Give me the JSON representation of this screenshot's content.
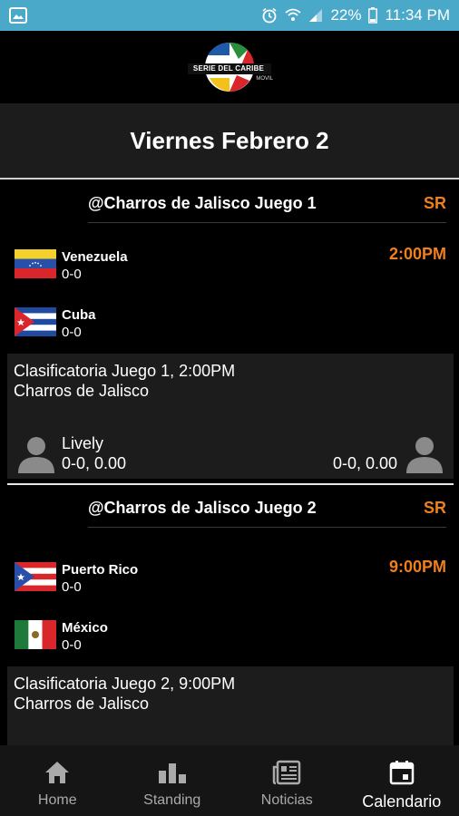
{
  "status_bar": {
    "battery_percent": "22%",
    "time": "11:34 PM"
  },
  "header": {
    "logo_text": "SERIE DEL CARIBE",
    "logo_sub": "MOVIL",
    "date_title": "Viernes Febrero 2"
  },
  "games": [
    {
      "title": "@Charros de Jalisco Juego 1",
      "status": "SR",
      "time": "2:00PM",
      "teams": [
        {
          "name": "Venezuela",
          "record": "0-0",
          "flag": "venezuela-flag-icon"
        },
        {
          "name": "Cuba",
          "record": "0-0",
          "flag": "cuba-flag-icon"
        }
      ],
      "info_line1": "Clasificatoria Juego 1, 2:00PM",
      "info_line2": "Charros de Jalisco",
      "pitcher_left_name": "Lively",
      "pitcher_left_stats": "0-0, 0.00",
      "pitcher_right_stats": "0-0, 0.00"
    },
    {
      "title": "@Charros de Jalisco Juego 2",
      "status": "SR",
      "time": "9:00PM",
      "teams": [
        {
          "name": "Puerto Rico",
          "record": "0-0",
          "flag": "puerto-rico-flag-icon"
        },
        {
          "name": "México",
          "record": "0-0",
          "flag": "mexico-flag-icon"
        }
      ],
      "info_line1": "Clasificatoria Juego 2, 9:00PM",
      "info_line2": "Charros de Jalisco"
    }
  ],
  "bottom_nav": [
    {
      "label": "Home",
      "icon": "home-icon"
    },
    {
      "label": "Standing",
      "icon": "standing-icon"
    },
    {
      "label": "Noticias",
      "icon": "news-icon"
    },
    {
      "label": "Calendario",
      "icon": "calendar-icon",
      "active": true
    }
  ],
  "colors": {
    "accent": "#f07f1e",
    "status_bar": "#4aa9c9",
    "panel": "#1c1c1c"
  }
}
